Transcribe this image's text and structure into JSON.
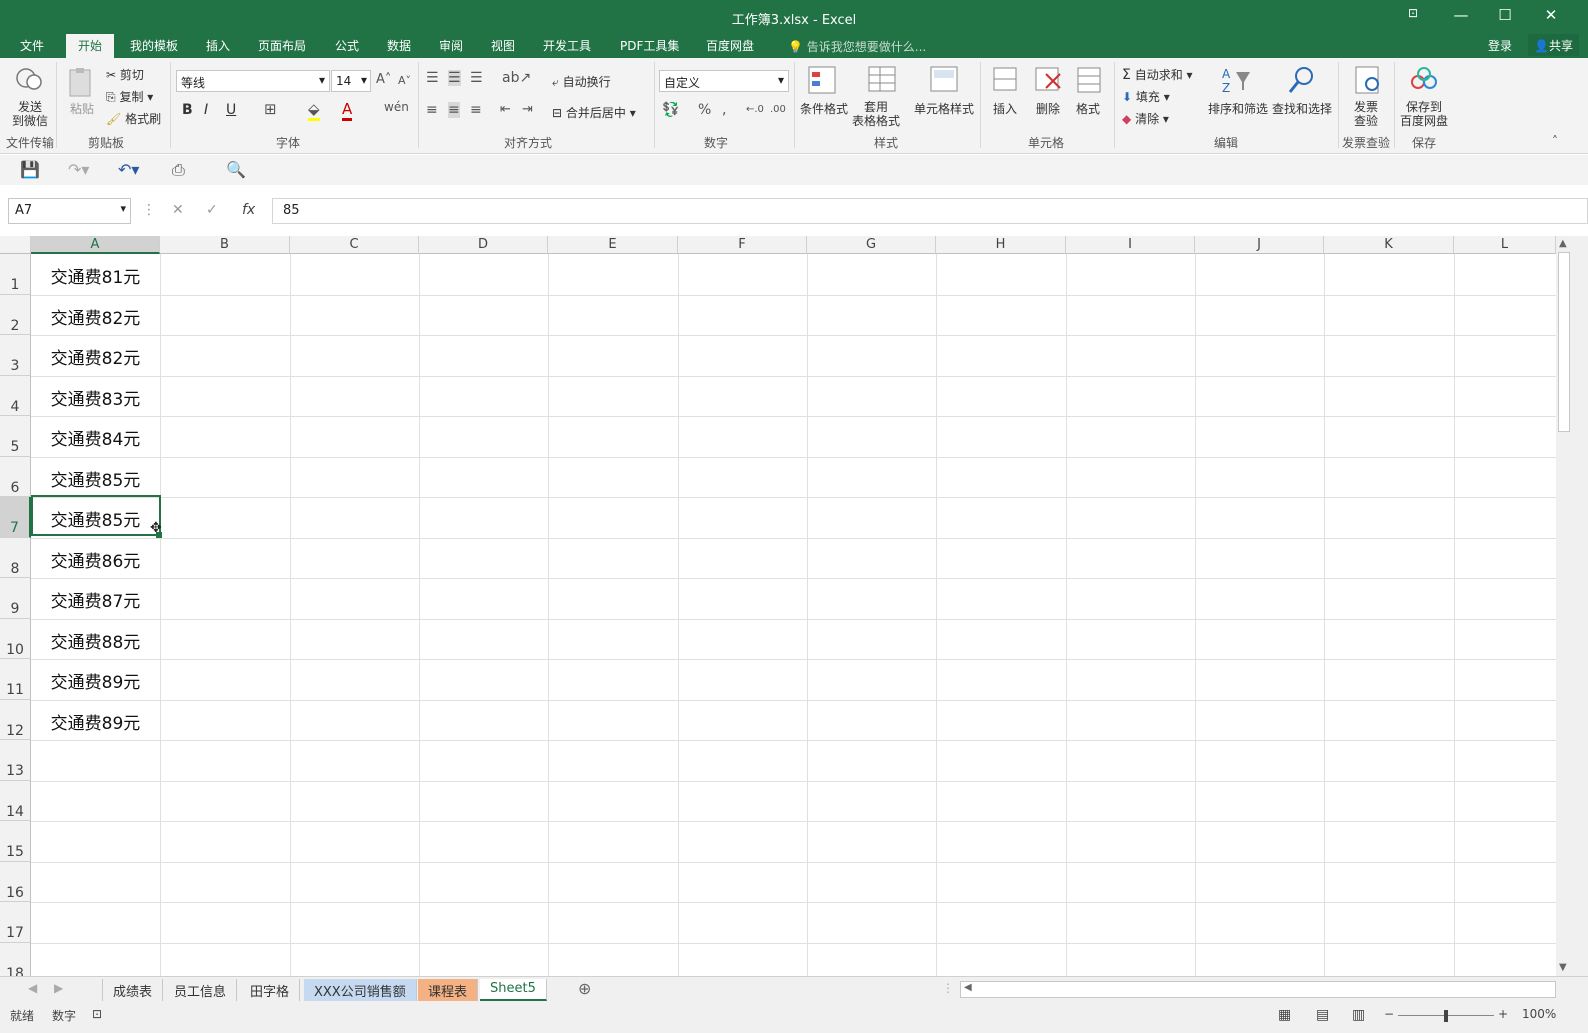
{
  "window": {
    "title": "工作簿3.xlsx - Excel"
  },
  "menu": {
    "tabs": [
      "文件",
      "开始",
      "我的模板",
      "插入",
      "页面布局",
      "公式",
      "数据",
      "审阅",
      "视图",
      "开发工具",
      "PDF工具集",
      "百度网盘"
    ],
    "active": "开始",
    "tell": "告诉我您想要做什么...",
    "login": "登录",
    "share": "共享"
  },
  "ribbon": {
    "send_wechat": "发送\n到微信",
    "paste": "粘贴",
    "cut": "剪切",
    "copy": "复制",
    "format_painter": "格式刷",
    "font_name": "等线",
    "font_size": "14",
    "wrap": "自动换行",
    "merge": "合并后居中",
    "number_format": "自定义",
    "cond_format": "条件格式",
    "table_format": "套用\n表格格式",
    "cell_style": "单元格样式",
    "insert": "插入",
    "delete": "删除",
    "format": "格式",
    "autosum": "自动求和",
    "fill": "填充",
    "clear": "清除",
    "sort_filter": "排序和筛选",
    "find_select": "查找和选择",
    "invoice": "发票\n查验",
    "save_baidu": "保存到\n百度网盘",
    "groups": [
      "文件传输",
      "剪贴板",
      "字体",
      "对齐方式",
      "数字",
      "样式",
      "单元格",
      "编辑",
      "发票查验",
      "保存"
    ]
  },
  "formula_bar": {
    "name_box": "A7",
    "value": "85"
  },
  "columns": [
    "A",
    "B",
    "C",
    "D",
    "E",
    "F",
    "G",
    "H",
    "I",
    "J",
    "K",
    "L"
  ],
  "rows": [
    "1",
    "2",
    "3",
    "4",
    "5",
    "6",
    "7",
    "8",
    "9",
    "10",
    "11",
    "12",
    "13",
    "14",
    "15",
    "16",
    "17",
    "18"
  ],
  "cells_a": [
    "交通费81元",
    "交通费82元",
    "交通费82元",
    "交通费83元",
    "交通费84元",
    "交通费85元",
    "交通费85元",
    "交通费86元",
    "交通费87元",
    "交通费88元",
    "交通费89元",
    "交通费89元"
  ],
  "sheets": [
    "成绩表",
    "员工信息",
    "田字格",
    "XXX公司销售额",
    "课程表",
    "Sheet5"
  ],
  "active_sheet": "Sheet5",
  "status": {
    "ready": "就绪",
    "mode": "数字",
    "zoom": "100%"
  },
  "colors": {
    "accent": "#217346",
    "sheet_blue": "#c5d9f1",
    "sheet_orange": "#f4b183"
  }
}
